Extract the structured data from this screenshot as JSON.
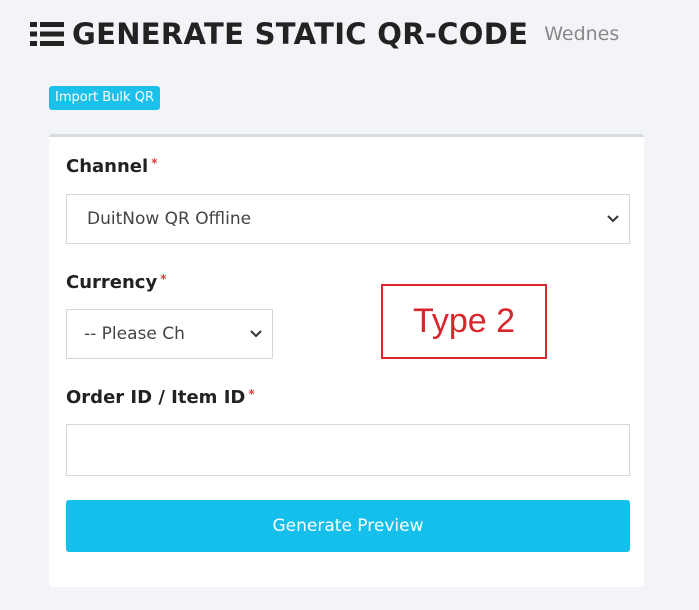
{
  "header": {
    "icon": "list-icon",
    "title": "GENERATE STATIC QR-CODE",
    "date_partial": "Wednes"
  },
  "import_button": {
    "label": "Import Bulk QR"
  },
  "form": {
    "channel": {
      "label": "Channel",
      "required_mark": "*",
      "selected": "DuitNow QR Offline"
    },
    "currency": {
      "label": "Currency",
      "required_mark": "*",
      "selected": "-- Please Ch"
    },
    "order_id": {
      "label": "Order ID / Item ID",
      "required_mark": "*",
      "value": "",
      "placeholder": ""
    },
    "generate_button": {
      "label": "Generate Preview"
    }
  },
  "annotation": {
    "text": "Type 2",
    "color": "#d8262c"
  },
  "colors": {
    "accent": "#14bfeb",
    "required": "#e03c3c"
  }
}
